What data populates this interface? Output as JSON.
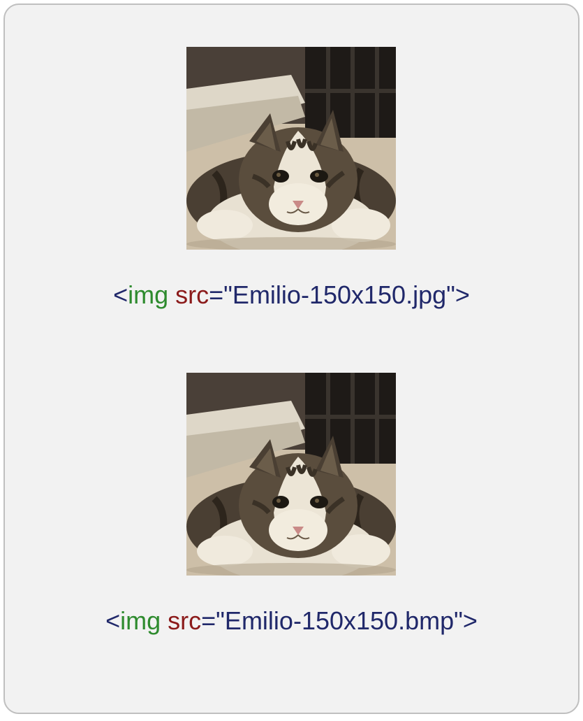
{
  "examples": [
    {
      "tag": "img",
      "attr": "src",
      "value": "\"Emilio-150x150.jpg\"",
      "open": "<",
      "eq": "=",
      "close": ">"
    },
    {
      "tag": "img",
      "attr": "src",
      "value": "\"Emilio-150x150.bmp\"",
      "open": "<",
      "eq": "=",
      "close": ">"
    }
  ]
}
